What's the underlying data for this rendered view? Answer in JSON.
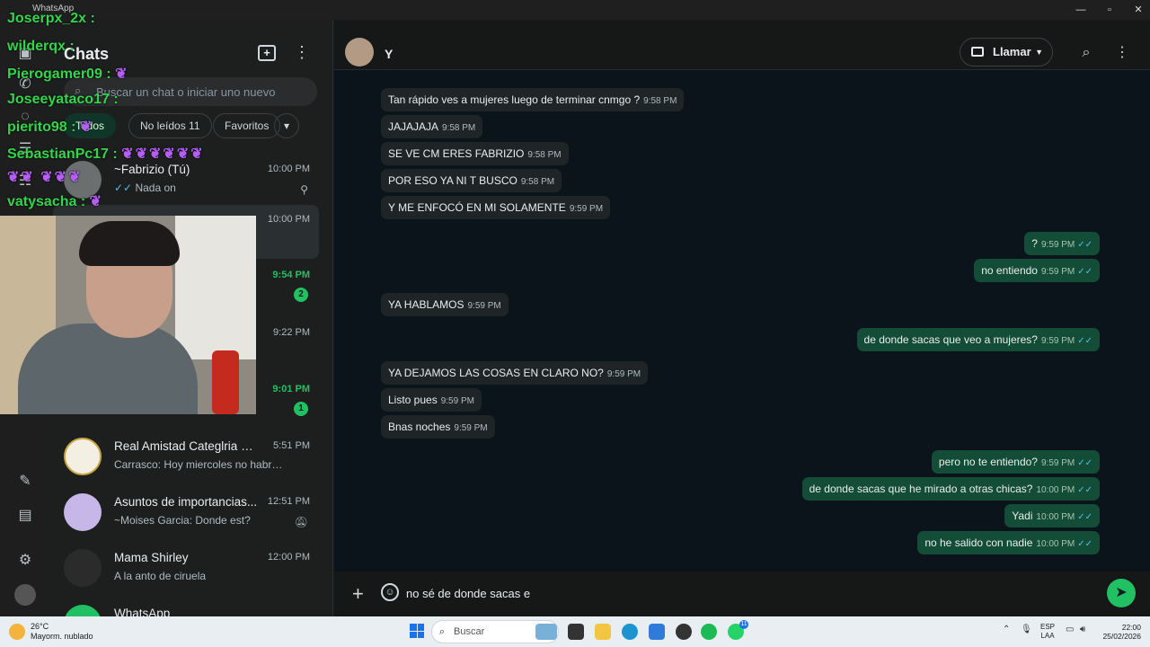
{
  "window": {
    "title": "WhatsApp"
  },
  "sidebar": {
    "title": "Chats",
    "search_placeholder": "Buscar un chat o iniciar uno nuevo",
    "filters": [
      "Todos",
      "No leídos 11",
      "Favoritos"
    ],
    "chats": [
      {
        "name": "~Fabrizio (Tú)",
        "preview": "Nada on",
        "time": "10:00 PM",
        "pinned": true
      },
      {
        "name": "",
        "preview": "",
        "time": "10:00 PM",
        "selected": true
      },
      {
        "name": "",
        "preview": "",
        "time": "9:54 PM",
        "unread": "2"
      },
      {
        "name": "",
        "preview": "",
        "time": "9:22 PM"
      },
      {
        "name": "",
        "preview": "",
        "time": "9:01 PM",
        "unread": "1"
      },
      {
        "name": "Real Amistad Categlria 200...",
        "preview": "Carrasco: Hoy miercoles no habrá entr...",
        "time": "5:51 PM"
      },
      {
        "name": "Asuntos de importancias...",
        "preview": "~Moises Garcia: Donde est?",
        "time": "12:51 PM",
        "muted": true
      },
      {
        "name": "Mama Shirley",
        "preview": "A la anto de ciruela",
        "time": "12:00 PM"
      },
      {
        "name": "WhatsApp",
        "preview": "",
        "time": ""
      }
    ]
  },
  "chat": {
    "contact_name": "Y",
    "call_label": "Llamar",
    "messages": [
      {
        "dir": "in",
        "text": "Tan rápido ves a mujeres luego de terminar cnmgo ?",
        "time": "9:58 PM"
      },
      {
        "dir": "in",
        "text": "JAJAJAJA",
        "time": "9:58 PM"
      },
      {
        "dir": "in",
        "text": "SE VE  CM ERES FABRIZIO",
        "time": "9:58 PM"
      },
      {
        "dir": "in",
        "text": "POR ESO YA NI T BUSCO",
        "time": "9:58 PM"
      },
      {
        "dir": "in",
        "text": "Y ME ENFOCÓ EN MI SOLAMENTE",
        "time": "9:59 PM"
      },
      {
        "dir": "out",
        "text": "?",
        "time": "9:59 PM"
      },
      {
        "dir": "out",
        "text": "no entiendo",
        "time": "9:59 PM"
      },
      {
        "dir": "in",
        "text": "YA HABLAMOS",
        "time": "9:59 PM"
      },
      {
        "dir": "out",
        "text": "de donde sacas que veo a mujeres?",
        "time": "9:59 PM"
      },
      {
        "dir": "in",
        "text": "YA DEJAMOS LAS COSAS EN CLARO NO?",
        "time": "9:59 PM"
      },
      {
        "dir": "in",
        "text": "Listo pues",
        "time": "9:59 PM"
      },
      {
        "dir": "in",
        "text": "Bnas noches",
        "time": "9:59 PM"
      },
      {
        "dir": "out",
        "text": "pero no te entiendo?",
        "time": "9:59 PM"
      },
      {
        "dir": "out",
        "text": "de donde sacas que he mirado a otras chicas?",
        "time": "10:00 PM"
      },
      {
        "dir": "out",
        "text": "Yadi",
        "time": "10:00 PM"
      },
      {
        "dir": "out",
        "text": "no he salido con nadie",
        "time": "10:00 PM"
      }
    ],
    "composer_value": "no sé de donde sacas e"
  },
  "overlay_chat": [
    {
      "user": "Joserpx_2x",
      "text": ":"
    },
    {
      "user": "wilderqx",
      "text": ":"
    },
    {
      "user": "Pierogamer09",
      "text": ":"
    },
    {
      "user": "Joseeyataco17",
      "text": ":"
    },
    {
      "user": "pierito98",
      "text": ":"
    },
    {
      "user": "SebastianPc17",
      "text": ":"
    },
    {
      "user": "vatysacha",
      "text": ":"
    }
  ],
  "taskbar": {
    "weather_temp": "26°C",
    "weather_desc": "Mayorm. nublado",
    "search_label": "Buscar",
    "lang_1": "ESP",
    "lang_2": "LAA",
    "time": "22:00",
    "date": "25/02/2026",
    "whatsapp_badge": "11"
  },
  "colors": {
    "accent": "#21c063",
    "outgoing_bubble": "#144d37",
    "incoming_bubble": "#1f2526"
  }
}
